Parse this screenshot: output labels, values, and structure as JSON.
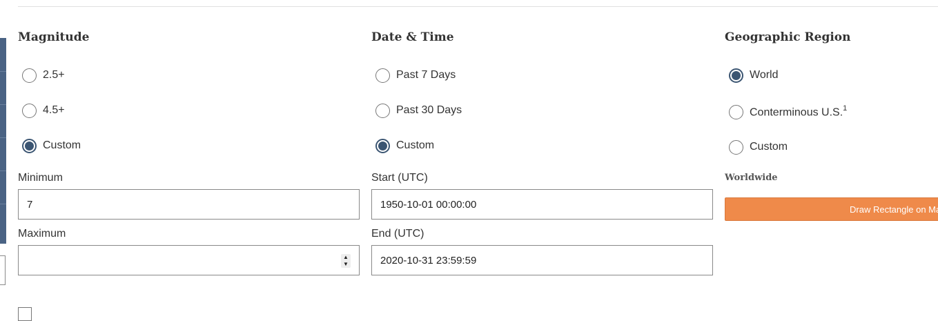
{
  "magnitude": {
    "heading": "Magnitude",
    "options": [
      {
        "label": "2.5+",
        "checked": false
      },
      {
        "label": "4.5+",
        "checked": false
      },
      {
        "label": "Custom",
        "checked": true
      }
    ],
    "min_label": "Minimum",
    "min_value": "7",
    "max_label": "Maximum",
    "max_value": ""
  },
  "datetime": {
    "heading": "Date & Time",
    "options": [
      {
        "label": "Past 7 Days",
        "checked": false
      },
      {
        "label": "Past 30 Days",
        "checked": false
      },
      {
        "label": "Custom",
        "checked": true
      }
    ],
    "start_label": "Start (UTC)",
    "start_value": "1950-10-01 00:00:00",
    "end_label": "End (UTC)",
    "end_value": "2020-10-31 23:59:59"
  },
  "region": {
    "heading": "Geographic Region",
    "options": [
      {
        "label": "World",
        "checked": true,
        "sup": ""
      },
      {
        "label": "Conterminous U.S.",
        "checked": false,
        "sup": "1"
      },
      {
        "label": "Custom",
        "checked": false,
        "sup": ""
      }
    ],
    "subheading": "Worldwide",
    "draw_button": "Draw Rectangle on Map"
  },
  "colors": {
    "accent": "#3b5572",
    "button": "#ef8a4a",
    "sidebar": "#4a6384"
  }
}
